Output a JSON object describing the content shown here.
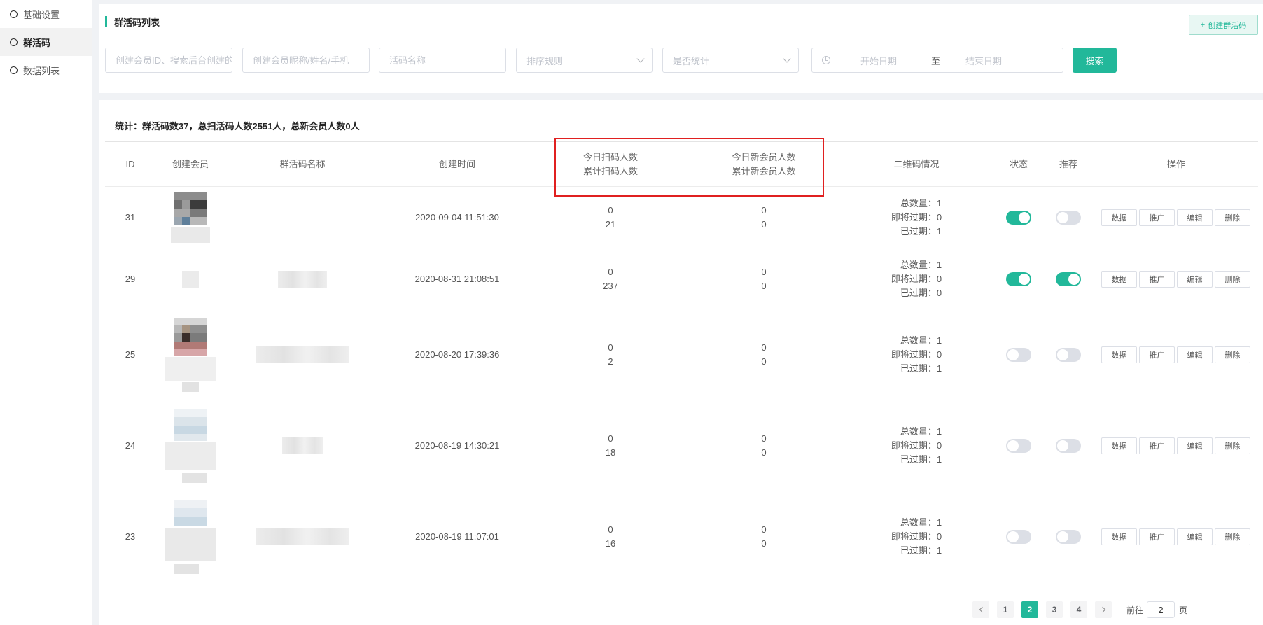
{
  "sidebar": {
    "items": [
      {
        "label": "基础设置",
        "active": false
      },
      {
        "label": "群活码",
        "active": true
      },
      {
        "label": "数据列表",
        "active": false
      }
    ]
  },
  "header": {
    "title": "群活码列表",
    "create_button": "创建群活码"
  },
  "filters": {
    "member_id_placeholder": "创建会员ID、搜索后台创建的",
    "member_name_placeholder": "创建会员昵称/姓名/手机",
    "code_name_placeholder": "活码名称",
    "sort_placeholder": "排序规则",
    "stat_placeholder": "是否统计",
    "date_start_placeholder": "开始日期",
    "date_separator": "至",
    "date_end_placeholder": "结束日期",
    "search_button": "搜索"
  },
  "stats": {
    "text": "统计：群活码数37，总扫活码人数2551人，总新会员人数0人"
  },
  "table": {
    "columns": {
      "id": "ID",
      "member": "创建会员",
      "name": "群活码名称",
      "created": "创建时间",
      "scan_today": "今日扫码人数",
      "scan_total": "累计扫码人数",
      "new_today": "今日新会员人数",
      "new_total": "累计新会员人数",
      "qr": "二维码情况",
      "status": "状态",
      "recommend": "推荐",
      "actions": "操作"
    },
    "qr_labels": {
      "total": "总数量：",
      "expiring": "即将过期：",
      "expired": "已过期："
    },
    "action_labels": [
      "数据",
      "推广",
      "编辑",
      "删除"
    ],
    "rows": [
      {
        "id": "31",
        "name": "—",
        "created": "2020-09-04 11:51:30",
        "scan_today": "0",
        "scan_total": "21",
        "new_today": "0",
        "new_total": "0",
        "qr_total": "1",
        "qr_expiring": "0",
        "qr_expired": "1",
        "status": true,
        "recommend": false
      },
      {
        "id": "29",
        "name": "",
        "created": "2020-08-31 21:08:51",
        "scan_today": "0",
        "scan_total": "237",
        "new_today": "0",
        "new_total": "0",
        "qr_total": "1",
        "qr_expiring": "0",
        "qr_expired": "0",
        "status": true,
        "recommend": true
      },
      {
        "id": "25",
        "name": "",
        "created": "2020-08-20 17:39:36",
        "scan_today": "0",
        "scan_total": "2",
        "new_today": "0",
        "new_total": "0",
        "qr_total": "1",
        "qr_expiring": "0",
        "qr_expired": "1",
        "status": false,
        "recommend": false
      },
      {
        "id": "24",
        "name": "",
        "created": "2020-08-19 14:30:21",
        "scan_today": "0",
        "scan_total": "18",
        "new_today": "0",
        "new_total": "0",
        "qr_total": "1",
        "qr_expiring": "0",
        "qr_expired": "1",
        "status": false,
        "recommend": false
      },
      {
        "id": "23",
        "name": "",
        "created": "2020-08-19 11:07:01",
        "scan_today": "0",
        "scan_total": "16",
        "new_today": "0",
        "new_total": "0",
        "qr_total": "1",
        "qr_expiring": "0",
        "qr_expired": "1",
        "status": false,
        "recommend": false
      }
    ]
  },
  "pagination": {
    "pages": [
      "1",
      "2",
      "3",
      "4"
    ],
    "current": "2",
    "goto_label": "前往",
    "goto_value": "2",
    "goto_suffix": "页"
  },
  "colors": {
    "accent": "#22b89a",
    "highlight_border": "#e02020"
  }
}
